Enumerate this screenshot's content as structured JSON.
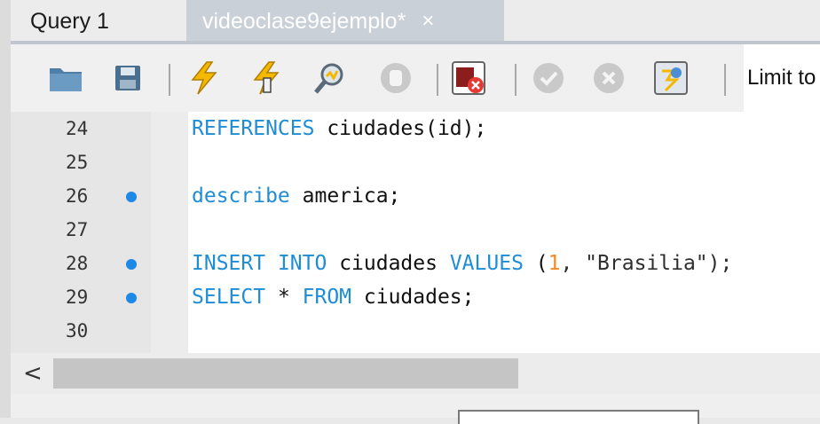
{
  "tabs": [
    {
      "label": "Query 1",
      "active": true
    },
    {
      "label": "videoclase9ejemplo*",
      "active": false,
      "close": "×"
    }
  ],
  "toolbar": {
    "icons": [
      "open-folder-icon",
      "save-icon",
      "execute-icon",
      "execute-current-icon",
      "explain-icon",
      "stop-icon",
      "toggle-error-stop-icon",
      "commit-icon",
      "rollback-icon",
      "autocommit-icon"
    ],
    "limit_label": "Limit to"
  },
  "editor": {
    "lines": [
      {
        "number": "24",
        "marker": false,
        "tokens": [
          {
            "t": "REFERENCES",
            "c": "kw"
          },
          {
            "t": " ciudades(id);",
            "c": ""
          }
        ]
      },
      {
        "number": "25",
        "marker": false,
        "tokens": []
      },
      {
        "number": "26",
        "marker": true,
        "tokens": [
          {
            "t": "describe",
            "c": "kw"
          },
          {
            "t": " america;",
            "c": ""
          }
        ]
      },
      {
        "number": "27",
        "marker": false,
        "tokens": []
      },
      {
        "number": "28",
        "marker": true,
        "tokens": [
          {
            "t": "INSERT",
            "c": "kw"
          },
          {
            "t": " ",
            "c": ""
          },
          {
            "t": "INTO",
            "c": "kw"
          },
          {
            "t": " ciudades ",
            "c": ""
          },
          {
            "t": "VALUES",
            "c": "kw"
          },
          {
            "t": " (",
            "c": ""
          },
          {
            "t": "1",
            "c": "num"
          },
          {
            "t": ", \"Brasilia\");",
            "c": "str"
          }
        ]
      },
      {
        "number": "29",
        "marker": true,
        "tokens": [
          {
            "t": "SELECT",
            "c": "kw"
          },
          {
            "t": " * ",
            "c": ""
          },
          {
            "t": "FROM",
            "c": "kw"
          },
          {
            "t": " ciudades;",
            "c": ""
          }
        ]
      },
      {
        "number": "30",
        "marker": false,
        "tokens": []
      }
    ]
  },
  "scrollbar": {
    "left_arrow": "<"
  },
  "colors": {
    "keyword": "#1f8dd6",
    "number": "#f08a24",
    "marker": "#1e88e5"
  }
}
